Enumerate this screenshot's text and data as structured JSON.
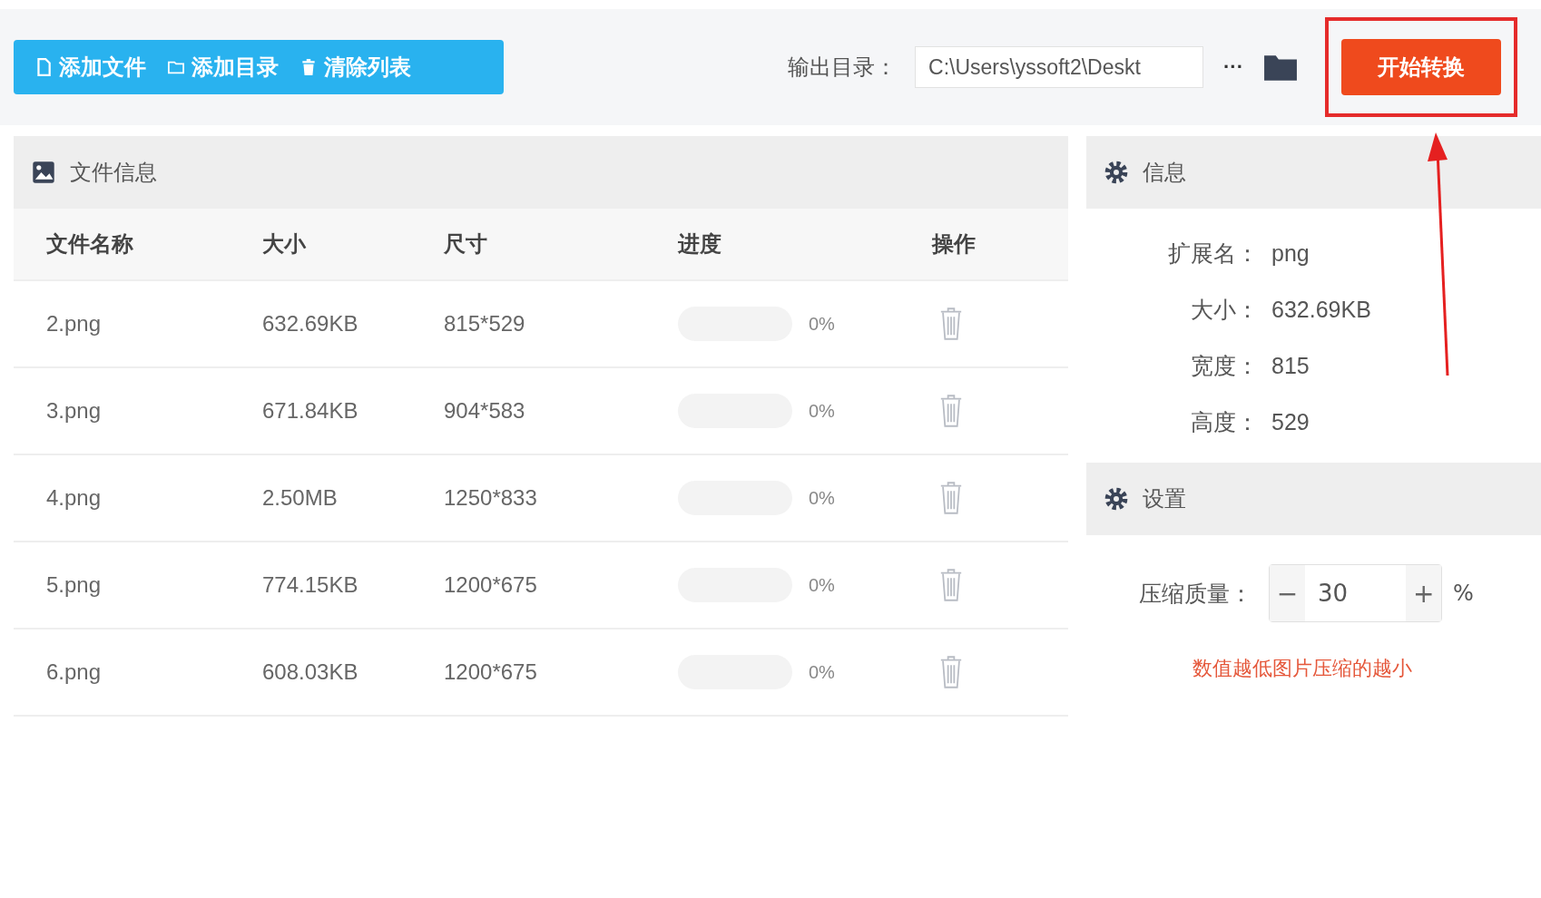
{
  "toolbar": {
    "buttons": [
      {
        "kind": "file",
        "label": "添加文件"
      },
      {
        "kind": "folder",
        "label": "添加目录"
      },
      {
        "kind": "trash",
        "label": "清除列表"
      }
    ]
  },
  "output": {
    "label": "输出目录：",
    "value": "C:\\Users\\yssoft2\\Deskt",
    "more": "···"
  },
  "start_button": "开始转换",
  "files_panel": {
    "title": "文件信息",
    "columns": [
      "文件名称",
      "大小",
      "尺寸",
      "进度",
      "操作"
    ],
    "rows": [
      {
        "name": "2.png",
        "size": "632.69KB",
        "dimensions": "815*529",
        "level": 0,
        "progress": "0%"
      },
      {
        "name": "3.png",
        "size": "671.84KB",
        "dimensions": "904*583",
        "level": 0,
        "progress": "0%"
      },
      {
        "name": "4.png",
        "size": "2.50MB",
        "dimensions": "1250*833",
        "level": 0,
        "progress": "0%"
      },
      {
        "name": "5.png",
        "size": "774.15KB",
        "dimensions": "1200*675",
        "level": 0,
        "progress": "0%"
      },
      {
        "name": "6.png",
        "size": "608.03KB",
        "dimensions": "1200*675",
        "level": 0,
        "progress": "0%"
      }
    ]
  },
  "info_panel": {
    "title": "信息",
    "fields": [
      {
        "label": "扩展名：",
        "value": "png"
      },
      {
        "label": "大小：",
        "value": "632.69KB"
      },
      {
        "label": "宽度：",
        "value": "815"
      },
      {
        "label": "高度：",
        "value": "529"
      }
    ]
  },
  "settings_panel": {
    "title": "设置",
    "quality_label": "压缩质量：",
    "minus": "−",
    "value": "30",
    "plus": "+",
    "unit": "%",
    "hint": "数值越低图片压缩的越小"
  }
}
